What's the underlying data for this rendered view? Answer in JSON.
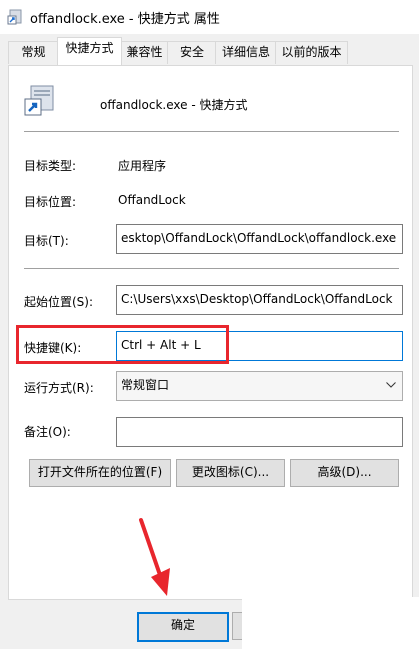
{
  "window": {
    "title": "offandlock.exe - 快捷方式 属性"
  },
  "tabs": [
    "常规",
    "快捷方式",
    "兼容性",
    "安全",
    "详细信息",
    "以前的版本"
  ],
  "shortcut": {
    "name": "offandlock.exe - 快捷方式"
  },
  "fields": {
    "target_type_label": "目标类型:",
    "target_type_value": "应用程序",
    "target_location_label": "目标位置:",
    "target_location_value": "OffandLock",
    "target_label": "目标(T):",
    "target_value": "esktop\\OffandLock\\OffandLock\\offandlock.exe",
    "start_in_label": "起始位置(S):",
    "start_in_value": "C:\\Users\\xxs\\Desktop\\OffandLock\\OffandLock",
    "hotkey_label": "快捷键(K):",
    "hotkey_value": "Ctrl + Alt + L",
    "run_label": "运行方式(R):",
    "run_value": "常规窗口",
    "comment_label": "备注(O):",
    "comment_value": ""
  },
  "buttons": {
    "open_location": "打开文件所在的位置(F)",
    "change_icon": "更改图标(C)...",
    "advanced": "高级(D)...",
    "ok": "确定"
  },
  "colors": {
    "annotation_red": "#e8262d",
    "selection_border": "#0078d7"
  }
}
